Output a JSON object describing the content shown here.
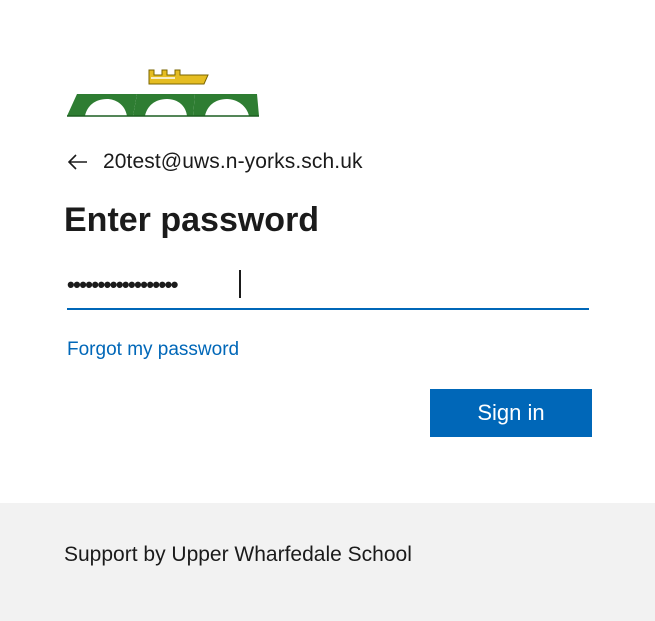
{
  "logo": {
    "icon": "school-crest-bridge-crown-logo",
    "colors": {
      "crown": "#e5bd22",
      "bridge": "#2e7d32"
    }
  },
  "identity": {
    "back_icon": "arrow-left-icon",
    "email": "20test@uws.n-yorks.sch.uk"
  },
  "title": "Enter password",
  "password": {
    "masked_value": "••••••••••••••••••"
  },
  "forgot_link": "Forgot my password",
  "signin_button": "Sign in",
  "footer": {
    "text": "Support by Upper Wharfedale School"
  },
  "colors": {
    "accent": "#0067b8",
    "footer_bg": "#f2f2f2",
    "text": "#1b1b1b"
  }
}
